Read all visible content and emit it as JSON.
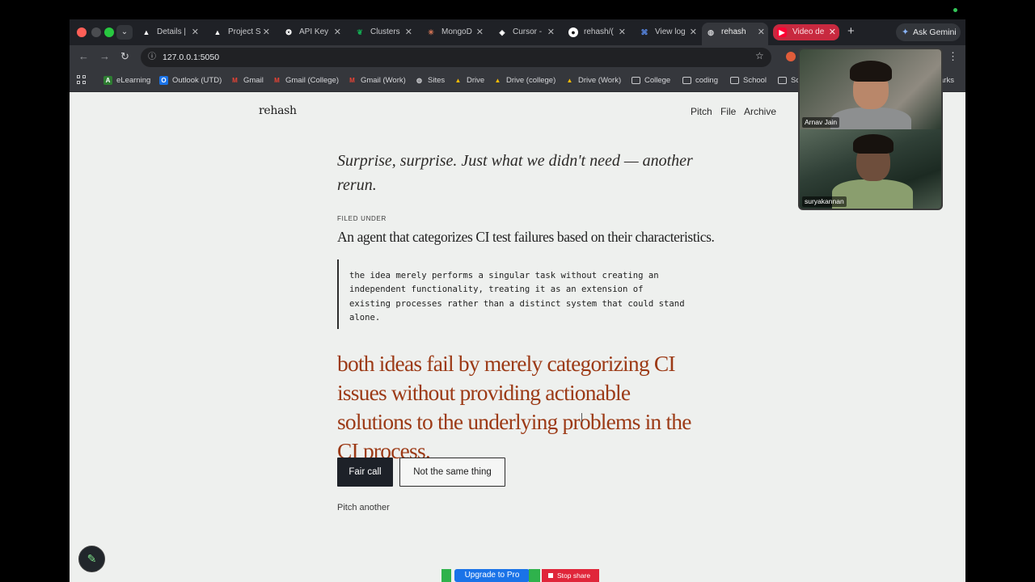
{
  "browser": {
    "tabs": [
      {
        "label": "Details |",
        "icon": "vercel-icon"
      },
      {
        "label": "Project S",
        "icon": "vercel-icon"
      },
      {
        "label": "API Key",
        "icon": "openai-icon"
      },
      {
        "label": "Clusters",
        "icon": "mongodb-leaf-icon"
      },
      {
        "label": "MongoD",
        "icon": "claude-icon"
      },
      {
        "label": "Cursor -",
        "icon": "cursor-icon"
      },
      {
        "label": "rehash/(",
        "icon": "github-icon"
      },
      {
        "label": "View log",
        "icon": "logs-icon"
      },
      {
        "label": "rehash",
        "icon": "globe-icon"
      },
      {
        "label": "Video de",
        "icon": "youtube-icon"
      }
    ],
    "new_tab": "+",
    "gemini_label": "Ask Gemini",
    "url": "127.0.0.1:5050",
    "bookmarks": [
      {
        "label": "eLearning",
        "icon": "elearning-icon"
      },
      {
        "label": "Outlook (UTD)",
        "icon": "outlook-icon"
      },
      {
        "label": "Gmail",
        "icon": "gmail-icon"
      },
      {
        "label": "Gmail (College)",
        "icon": "gmail-icon"
      },
      {
        "label": "Gmail (Work)",
        "icon": "gmail-icon"
      },
      {
        "label": "Sites",
        "icon": "globe-icon"
      },
      {
        "label": "Drive",
        "icon": "drive-icon"
      },
      {
        "label": "Drive (college)",
        "icon": "drive-icon"
      },
      {
        "label": "Drive (Work)",
        "icon": "drive-icon"
      },
      {
        "label": "College",
        "icon": "folder-icon"
      },
      {
        "label": "coding",
        "icon": "folder-icon"
      },
      {
        "label": "School",
        "icon": "folder-icon"
      },
      {
        "label": "Sc",
        "icon": "folder-icon"
      }
    ],
    "bookmarks_overflow": "arks"
  },
  "site": {
    "brand": "rehash",
    "nav": [
      "Pitch",
      "File",
      "Archive"
    ]
  },
  "main": {
    "tagline": "Surprise, surprise. Just what we didn't need — another rerun.",
    "filed_label": "FILED UNDER",
    "headline": "An agent that categorizes CI test failures based on their characteristics.",
    "quote": "the idea merely performs a singular task without creating an independent functionality, treating it as an extension of existing processes rather than a distinct system that could stand alone.",
    "verdict": "both ideas fail by merely categorizing CI issues without providing actionable solutions to the underlying problems in the CI process.",
    "primary_button": "Fair call",
    "secondary_button": "Not the same thing",
    "pitch_another": "Pitch another"
  },
  "video_call": {
    "participants": [
      "Arnav Jain",
      "suryakannan"
    ]
  },
  "share_bar": {
    "upgrade_label": "Upgrade to Pro",
    "stop_label": "Stop share"
  },
  "colors": {
    "verdict": "#9c3a16",
    "primary_button": "#1d2128",
    "active_tab_red": "#c8293f",
    "upgrade_blue": "#1a73e8",
    "stop_red": "#e0263a"
  }
}
